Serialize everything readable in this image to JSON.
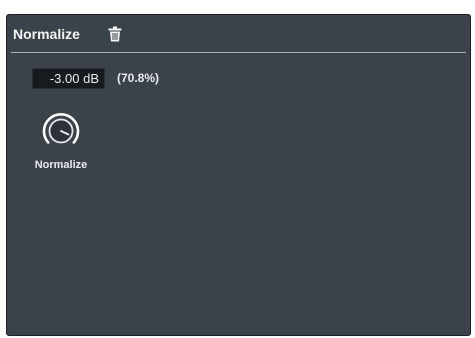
{
  "panel": {
    "title": "Normalize",
    "delete_icon": "trash-icon"
  },
  "normalize": {
    "value": "-3.00 dB",
    "percent": "(70.8%)",
    "knob_label": "Normalize",
    "knob_icon": "rotary-knob-icon"
  }
}
